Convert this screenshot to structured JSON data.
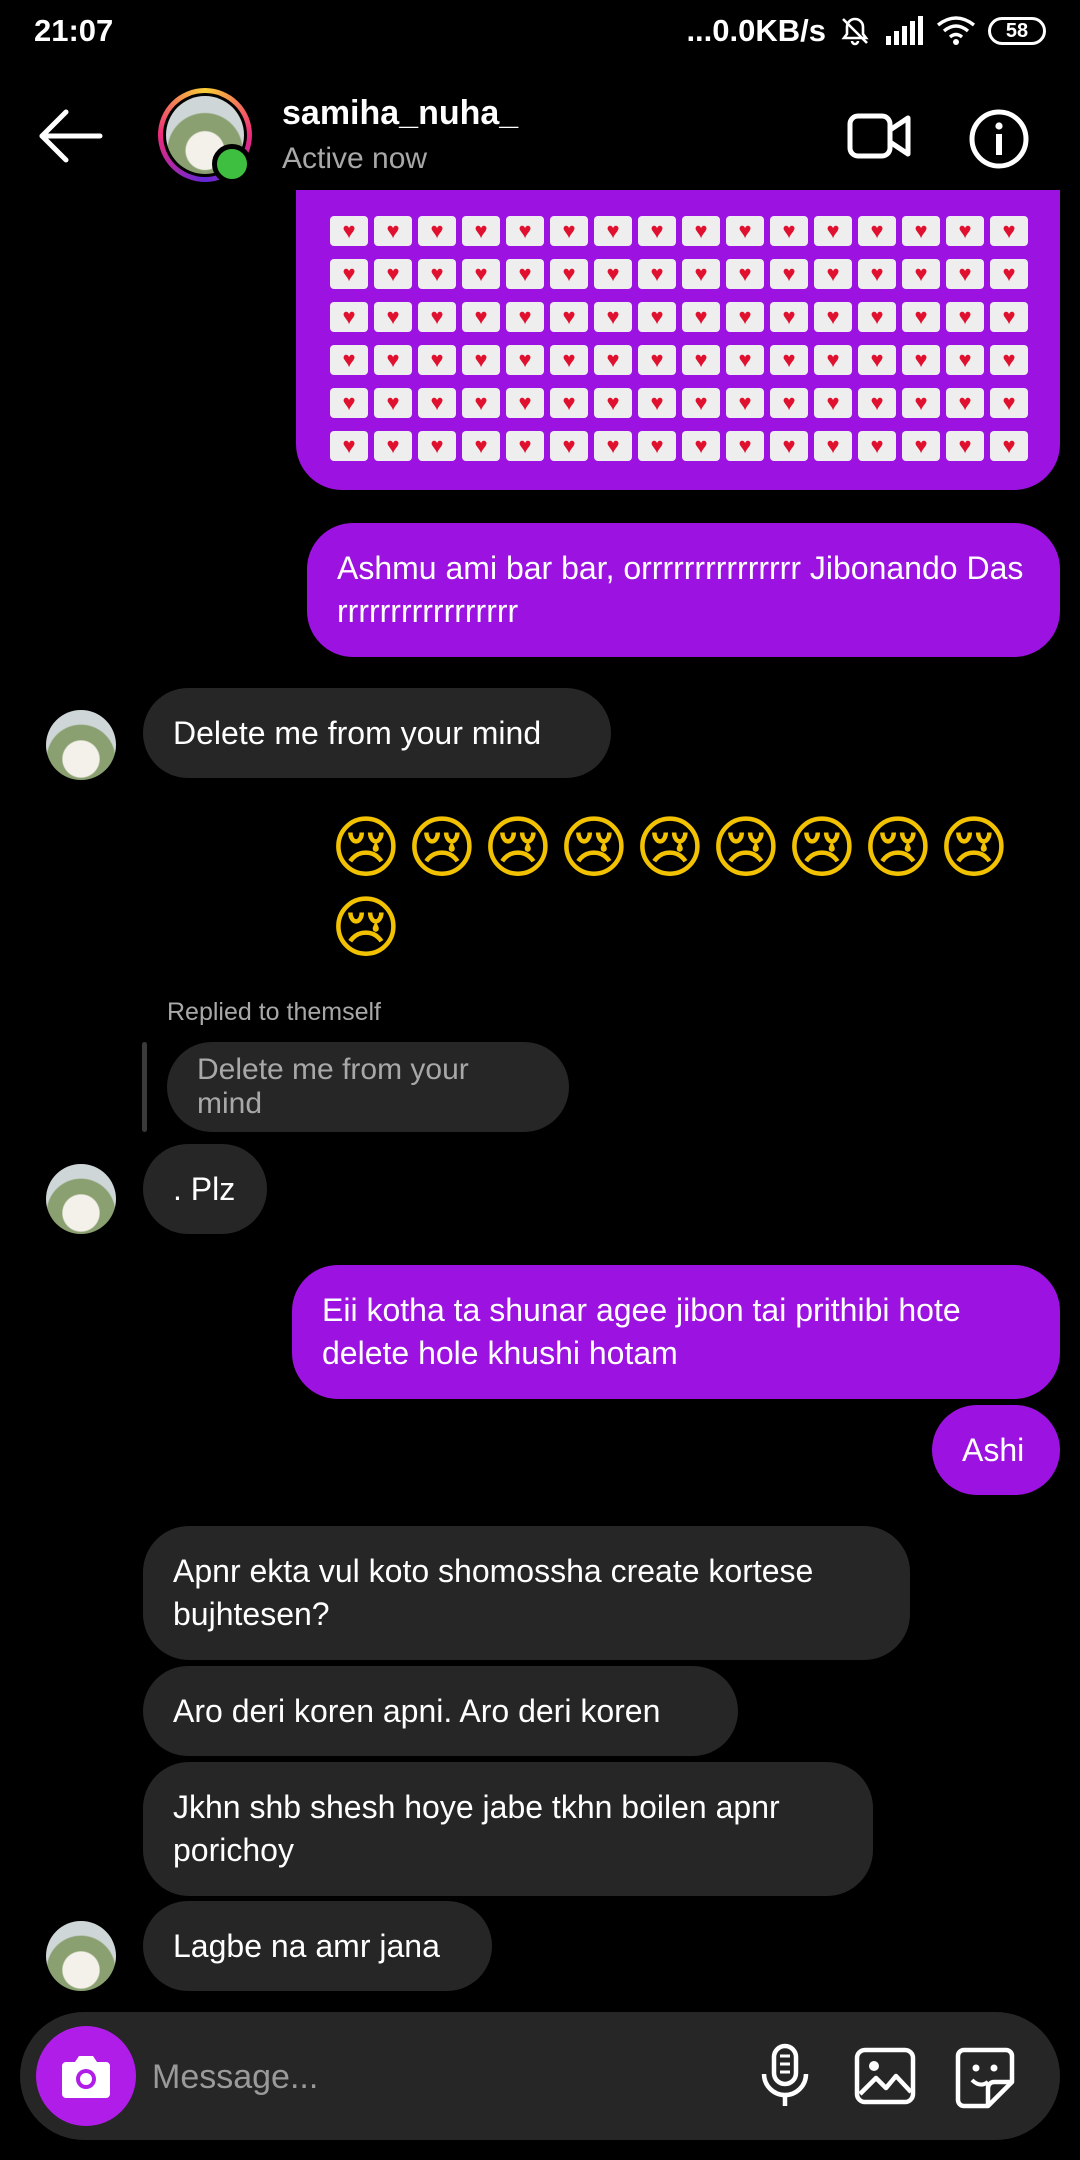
{
  "status_bar": {
    "time": "21:07",
    "network_speed": "...0.0KB/s",
    "battery": "58",
    "icons": [
      "mute-icon",
      "signal-icon",
      "wifi-icon",
      "battery-icon"
    ]
  },
  "header": {
    "contact_name": "samiha_nuha_",
    "contact_status": "Active now",
    "icons": [
      "back-arrow-icon",
      "video-call-icon",
      "info-icon"
    ]
  },
  "messages": {
    "m1_emoji_grid": "💌 × 96",
    "m2": "Ashmu ami bar bar,  orrrrrrrrrrrrrrr Jibonando Das rrrrrrrrrrrrrrrrr",
    "m3": "Delete me from your mind",
    "m4_emojis": "😢😢😢😢😢😢😢😢😢😢",
    "reply_label": "Replied to themself",
    "reply_quote": "Delete me from your mind",
    "m5": ". Plz",
    "m6": "Eii kotha ta shunar agee jibon tai prithibi hote delete hole khushi hotam",
    "m7": "Ashi",
    "m8": "Apnr ekta vul koto shomossha create kortese bujhtesen?",
    "m9": "Aro deri koren apni. Aro deri koren",
    "m10": "Jkhn shb shesh hoye jabe tkhn boilen apnr porichoy",
    "m11": "Lagbe na amr jana"
  },
  "composer": {
    "placeholder": "Message...",
    "icons": [
      "camera-icon",
      "microphone-icon",
      "gallery-icon",
      "sticker-icon"
    ]
  },
  "colors": {
    "background": "#000000",
    "outgoing_bubble": "#9c12e0",
    "incoming_bubble": "#262626",
    "camera_button": "#b11de8",
    "online_dot": "#3fbf3f"
  }
}
